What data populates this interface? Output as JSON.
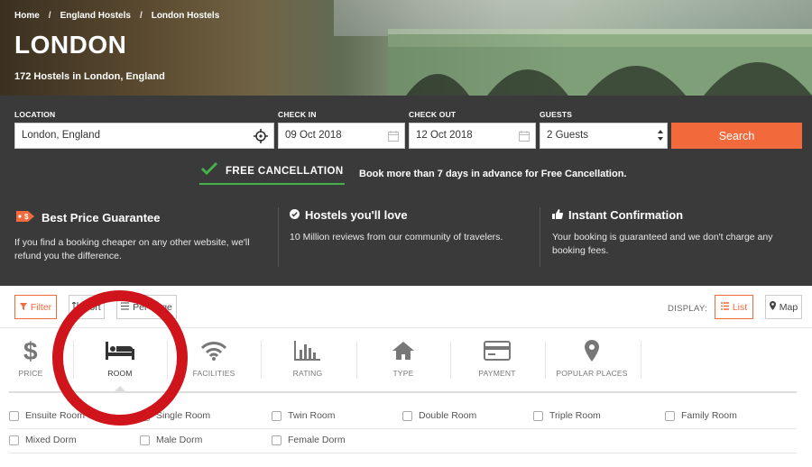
{
  "breadcrumb": [
    "Home",
    "England Hostels",
    "London Hostels"
  ],
  "breadcrumb_sep": "/",
  "hero": {
    "city": "LONDON",
    "count": "172 Hostels in London, England"
  },
  "search": {
    "location_label": "LOCATION",
    "location_value": "London, England",
    "checkin_label": "CHECK IN",
    "checkin_value": "09 Oct 2018",
    "checkout_label": "CHECK OUT",
    "checkout_value": "12 Oct 2018",
    "guests_label": "GUESTS",
    "guests_value": "2 Guests",
    "button": "Search"
  },
  "free_cancellation": {
    "label": "FREE CANCELLATION",
    "text": "Book more than 7 days in advance for Free Cancellation."
  },
  "features": [
    {
      "title": "Best Price Guarantee",
      "desc": "If you find a booking cheaper on any other website, we'll refund you the difference.",
      "icon": "price-tag-icon"
    },
    {
      "title": "Hostels you'll love",
      "desc": "10 Million reviews from our community of travelers.",
      "icon": "check-circle-icon"
    },
    {
      "title": "Instant Confirmation",
      "desc": "Your booking is guaranteed and we don't charge any booking fees.",
      "icon": "thumbs-up-icon"
    }
  ],
  "toolbar": {
    "filter": "Filter",
    "sort": "Sort",
    "per_page": "Per Page",
    "display": "DISPLAY:",
    "list": "List",
    "map": "Map"
  },
  "categories": [
    {
      "label": "PRICE",
      "icon": "dollar-icon"
    },
    {
      "label": "ROOM",
      "icon": "bed-icon"
    },
    {
      "label": "FACILITIES",
      "icon": "wifi-icon"
    },
    {
      "label": "RATING",
      "icon": "bar-chart-icon"
    },
    {
      "label": "TYPE",
      "icon": "home-icon"
    },
    {
      "label": "PAYMENT",
      "icon": "credit-card-icon"
    },
    {
      "label": "POPULAR PLACES",
      "icon": "map-pin-icon"
    }
  ],
  "room_options": [
    "Ensuite Room",
    "Single Room",
    "Twin Room",
    "Double Room",
    "Triple Room",
    "Family Room",
    "Mixed Dorm",
    "Male Dorm",
    "Female Dorm"
  ],
  "colors": {
    "accent": "#f26a3b",
    "panel": "#3a3a3a",
    "green": "#46b04a",
    "annotation": "#d0141b"
  }
}
